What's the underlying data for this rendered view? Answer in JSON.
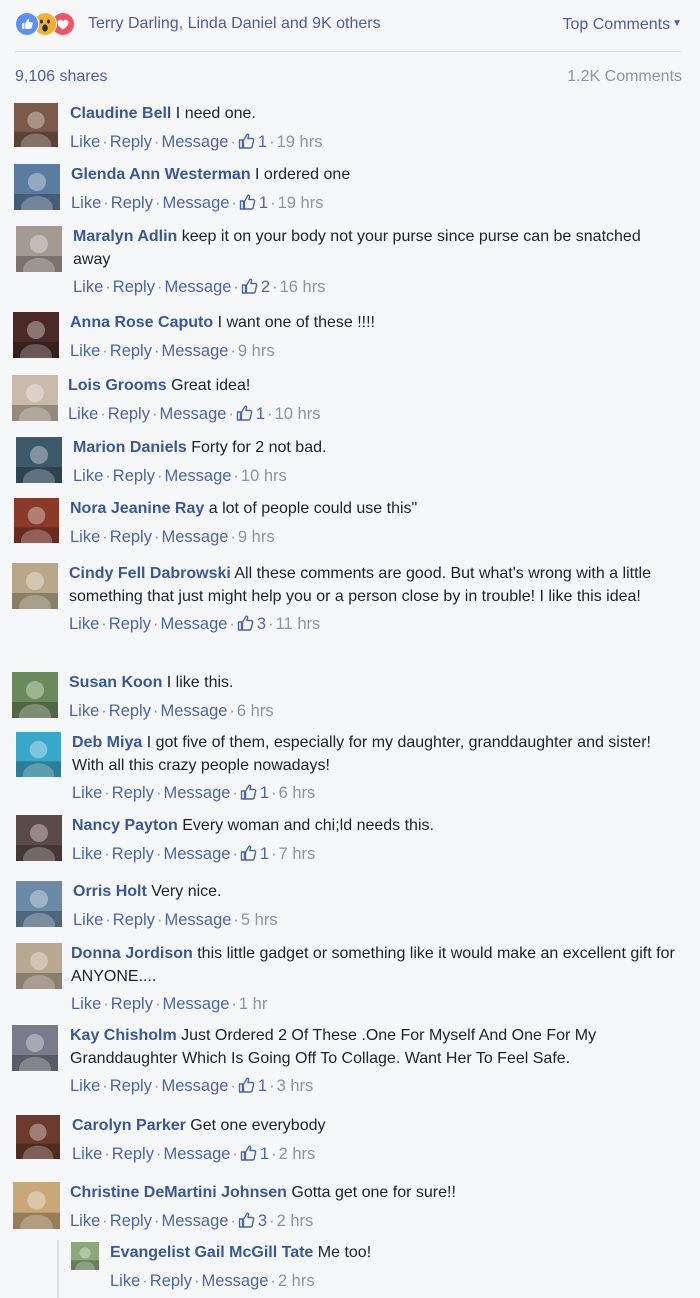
{
  "reactions": {
    "names": "Terry Darling, Linda Daniel and 9K others",
    "colors": {
      "like": "#5890ff",
      "wow": "#f7b125",
      "love": "#f25268"
    }
  },
  "top_comments_label": "Top Comments",
  "shares": "9,106 shares",
  "comments_count": "1.2K Comments",
  "action_labels": {
    "like": "Like",
    "reply": "Reply",
    "message": "Message"
  },
  "comments": [
    {
      "name": "Claudine Bell",
      "text": " I need one.",
      "likes": "1",
      "time": "19 hrs",
      "avatar_color": "#7b5a4a"
    },
    {
      "name": "Glenda Ann Westerman",
      "text": " I ordered one",
      "likes": "1",
      "time": "19 hrs",
      "avatar_color": "#5a7ca0"
    },
    {
      "name": "Maralyn Adlin",
      "text": " keep it on your body not your purse since purse can be snatched away",
      "likes": "2",
      "time": "16 hrs",
      "avatar_color": "#a39a92"
    },
    {
      "name": "Anna Rose Caputo",
      "text": " I want one of these !!!!",
      "likes": "",
      "time": "9 hrs",
      "avatar_color": "#4a2a26"
    },
    {
      "name": "Lois Grooms",
      "text": " Great idea!",
      "likes": "1",
      "time": "10 hrs",
      "avatar_color": "#c9b9a8"
    },
    {
      "name": "Marion Daniels",
      "text": " Forty for 2 not bad.",
      "likes": "",
      "time": "10 hrs",
      "avatar_color": "#3d5a6b"
    },
    {
      "name": "Nora Jeanine Ray",
      "text": " a lot of people could use this\"",
      "likes": "",
      "time": "9 hrs",
      "avatar_color": "#8b3a2a"
    },
    {
      "name": "Cindy Fell Dabrowski",
      "text": " All these comments are good. But what's wrong with a little something that just might help you or a person close by in trouble! I like this idea!",
      "likes": "3",
      "time": "11 hrs",
      "avatar_color": "#b8a888"
    },
    {
      "name": "Susan Koon",
      "text": " I like this.",
      "likes": "",
      "time": "6 hrs",
      "avatar_color": "#6a8a5a"
    },
    {
      "name": "Deb Miya",
      "text": " I got five of them, especially for my daughter, granddaughter and sister! With all this crazy people nowadays!",
      "likes": "1",
      "time": "6 hrs",
      "avatar_color": "#38a8c8"
    },
    {
      "name": "Nancy Payton",
      "text": " Every woman and chi;ld needs this.",
      "likes": "1",
      "time": "7 hrs",
      "avatar_color": "#5a4a4a"
    },
    {
      "name": "Orris Holt",
      "text": " Very nice.",
      "likes": "",
      "time": "5 hrs",
      "avatar_color": "#6a8aa8"
    },
    {
      "name": "Donna Jordison",
      "text": " this little gadget or something like it would make an excellent gift for ANYONE....",
      "likes": "",
      "time": "1 hr",
      "avatar_color": "#b8a890"
    },
    {
      "name": "Kay Chisholm",
      "text": " Just Ordered 2 Of These .One For Myself And One For My Granddaughter Which Is Going Off To Collage. Want Her To Feel Safe.",
      "likes": "1",
      "time": "3 hrs",
      "avatar_color": "#7a7a8a"
    },
    {
      "name": "Carolyn Parker",
      "text": " Get one everybody",
      "likes": "1",
      "time": "2 hrs",
      "avatar_color": "#6a3a2a"
    },
    {
      "name": "Christine DeMartini Johnsen",
      "text": " Gotta get one for sure!!",
      "likes": "3",
      "time": "2 hrs",
      "avatar_color": "#c8a878"
    },
    {
      "name": "Evangelist Gail McGill Tate",
      "text": " Me too!",
      "likes": "",
      "time": "2 hrs",
      "avatar_color": "#8aa878"
    }
  ]
}
